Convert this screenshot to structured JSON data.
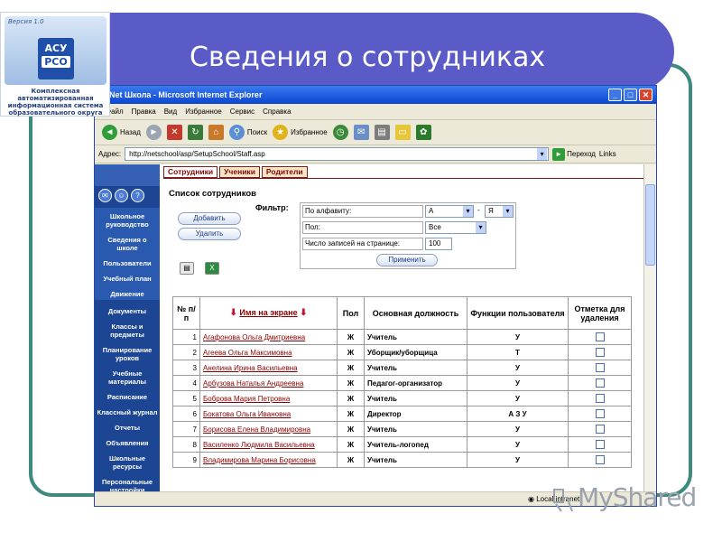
{
  "slide": {
    "title": "Сведения о сотрудниках"
  },
  "logo": {
    "version": "Версия 1.0",
    "line1": "АСУ",
    "line2": "РСО",
    "subtitle": "Комплексная автоматизированная информационная система образовательного округа"
  },
  "window": {
    "title": "Net Школа - Microsoft Internet Explorer"
  },
  "menu": [
    "Файл",
    "Правка",
    "Вид",
    "Избранное",
    "Сервис",
    "Справка"
  ],
  "toolbar": {
    "back": "Назад",
    "search": "Поиск",
    "favorites": "Избранное"
  },
  "address": {
    "label": "Адрес:",
    "url": "http://netschool/asp/SetupSchool/Staff.asp",
    "go": "Переход",
    "links": "Links"
  },
  "status": {
    "zone": "Local intranet"
  },
  "sidebar": {
    "group1": [
      "Школьное руководство",
      "Сведения о школе",
      "Пользователи",
      "Учебный план",
      "Движение"
    ],
    "group2": [
      "Документы",
      "Классы и предметы",
      "Планирование уроков",
      "Учебные материалы",
      "Расписание",
      "Классный журнал",
      "Отчеты",
      "Объявления",
      "Школьные ресурсы",
      "Персональные настройки"
    ]
  },
  "tabs": [
    "Сотрудники",
    "Ученики",
    "Родители"
  ],
  "page": {
    "heading": "Список сотрудников",
    "add": "Добавить",
    "delete": "Удалить"
  },
  "filter": {
    "label": "Фильтр:",
    "alpha_label": "По алфавиту:",
    "alpha_from": "А",
    "alpha_sep": "-",
    "alpha_to": "Я",
    "sex_label": "Пол:",
    "sex_value": "Все",
    "count_label": "Число записей на странице:",
    "count_value": "100",
    "apply": "Применить"
  },
  "table": {
    "headers": [
      "№ п/п",
      "Имя на экране",
      "Пол",
      "Основная должность",
      "Функции пользователя",
      "Отметка для удаления"
    ],
    "rows": [
      {
        "n": "1",
        "name": "Агафонова Ольга Дмитриевна",
        "sex": "Ж",
        "position": "Учитель",
        "func": "У"
      },
      {
        "n": "2",
        "name": "Агеева Ольга Максимовна",
        "sex": "Ж",
        "position": "Уборщик/уборщица",
        "func": "Т"
      },
      {
        "n": "3",
        "name": "Анелина Ирина Васильевна",
        "sex": "Ж",
        "position": "Учитель",
        "func": "У"
      },
      {
        "n": "4",
        "name": "Арбузова Наталья Андреевна",
        "sex": "Ж",
        "position": "Педагог-организатор",
        "func": "У"
      },
      {
        "n": "5",
        "name": "Боброва Мария Петровна",
        "sex": "Ж",
        "position": "Учитель",
        "func": "У"
      },
      {
        "n": "6",
        "name": "Бокатова Ольга Ивановна",
        "sex": "Ж",
        "position": "Директор",
        "func": "А З У"
      },
      {
        "n": "7",
        "name": "Борисова Елена Владимировна",
        "sex": "Ж",
        "position": "Учитель",
        "func": "У"
      },
      {
        "n": "8",
        "name": "Василенко Людмила Васильевна",
        "sex": "Ж",
        "position": "Учитель-логопед",
        "func": "У"
      },
      {
        "n": "9",
        "name": "Владимирова Марина Борисовна",
        "sex": "Ж",
        "position": "Учитель",
        "func": "У"
      }
    ]
  },
  "watermark": "MyShared"
}
